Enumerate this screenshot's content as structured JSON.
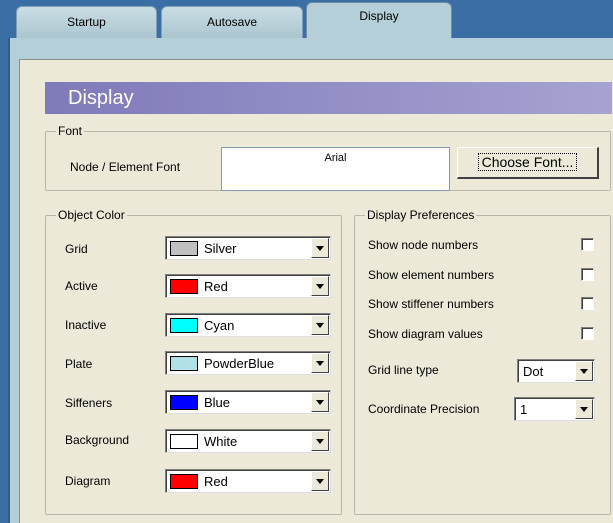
{
  "tabs": [
    {
      "label": "Startup"
    },
    {
      "label": "Autosave"
    },
    {
      "label": "Display"
    }
  ],
  "header": {
    "title": "Display"
  },
  "font_group": {
    "legend": "Font",
    "label": "Node / Element Font",
    "current_font": "Arial",
    "choose_button": "Choose Font..."
  },
  "object_color": {
    "legend": "Object Color",
    "items": [
      {
        "label": "Grid",
        "value": "Silver",
        "color": "#c0c0c0"
      },
      {
        "label": "Active",
        "value": "Red",
        "color": "#ff0000"
      },
      {
        "label": "Inactive",
        "value": "Cyan",
        "color": "#00ffff"
      },
      {
        "label": "Plate",
        "value": "PowderBlue",
        "color": "#b0e0e6"
      },
      {
        "label": "Siffeners",
        "value": "Blue",
        "color": "#0000ff"
      },
      {
        "label": "Background",
        "value": "White",
        "color": "#ffffff"
      },
      {
        "label": "Diagram",
        "value": "Red",
        "color": "#ff0000"
      }
    ]
  },
  "display_prefs": {
    "legend": "Display Preferences",
    "checks": [
      {
        "label": "Show node numbers",
        "checked": false
      },
      {
        "label": "Show element numbers",
        "checked": false
      },
      {
        "label": "Show stiffener numbers",
        "checked": false
      },
      {
        "label": "Show diagram values",
        "checked": false
      }
    ],
    "grid_line_type": {
      "label": "Grid line type",
      "value": "Dot"
    },
    "coord_precision": {
      "label": "Coordinate Precision",
      "value": "1"
    }
  }
}
